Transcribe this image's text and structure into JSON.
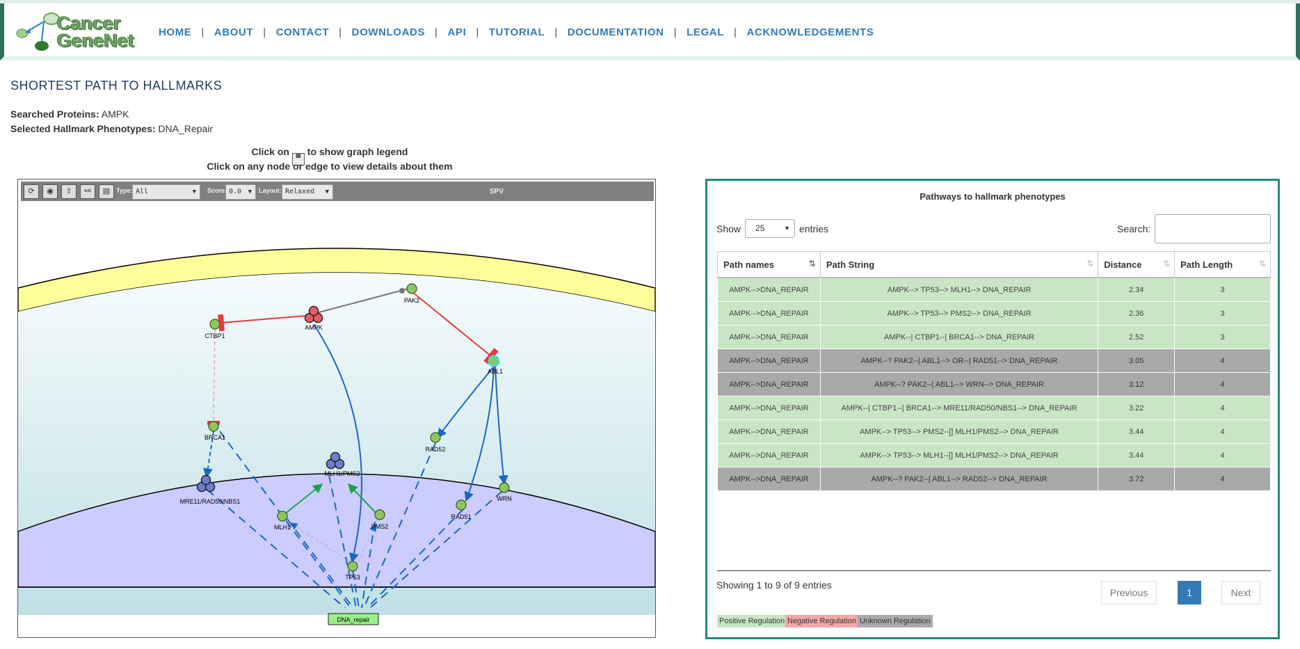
{
  "logo": {
    "line1": "Cancer",
    "line2": "GeneNet"
  },
  "nav": [
    "HOME",
    "ABOUT",
    "CONTACT",
    "DOWNLOADS",
    "API",
    "TUTORIAL",
    "DOCUMENTATION",
    "LEGAL",
    "ACKNOWLEDGEMENTS"
  ],
  "page": {
    "title": "SHORTEST PATH TO HALLMARKS",
    "searched_label": "Searched Proteins:",
    "searched_value": "AMPK",
    "hallmark_label": "Selected Hallmark Phenotypes:",
    "hallmark_value": "DNA_Repair",
    "hint1_pre": "Click on",
    "hint1_post": "to show graph legend",
    "hint2": "Click on any node or edge to view details about them"
  },
  "toolbar": {
    "type_label": "Type:",
    "type_value": "All",
    "score_label": "Score:",
    "score_value": "0.0",
    "layout_label": "Layout:",
    "layout_value": "Relaxed",
    "view_label": "SPV"
  },
  "graph": {
    "nodes": {
      "pak2": "PAK2",
      "ctbp1": "CTBP1",
      "ampk": "AMPK",
      "abl1": "ABL1",
      "rad52": "RAD52",
      "brca1": "BRCA1",
      "mlh1pms2": "MLH1/PMS2",
      "mlh1": "MLH1",
      "pms2": "PMS2",
      "wrn": "WRN",
      "rad51": "RAD51",
      "mre11": "MRE11/RAD50/NBS1",
      "tp53": "TP53",
      "dna_repair": "DNA_repair"
    },
    "colors": {
      "positive_edge": "#1a66c2",
      "negative_edge": "#e83a3a",
      "unknown_edge": "#777777",
      "node_green": "#8fc460",
      "complex_blue": "#6a7fd0",
      "ampk_red": "#e85a66"
    }
  },
  "table": {
    "title": "Pathways to hallmark phenotypes",
    "show_label": "Show",
    "show_value": "25",
    "entries_label": "entries",
    "search_label": "Search:",
    "columns": [
      "Path names",
      "Path String",
      "Distance",
      "Path Length"
    ],
    "rows": [
      {
        "name": "AMPK-->DNA_REPAIR",
        "path": "AMPK--> TP53--> MLH1--> DNA_REPAIR",
        "distance": "2.34",
        "length": "3",
        "type": "pos"
      },
      {
        "name": "AMPK-->DNA_REPAIR",
        "path": "AMPK--> TP53--> PMS2--> DNA_REPAIR",
        "distance": "2.36",
        "length": "3",
        "type": "pos"
      },
      {
        "name": "AMPK-->DNA_REPAIR",
        "path": "AMPK--| CTBP1--| BRCA1--> DNA_REPAIR",
        "distance": "2.52",
        "length": "3",
        "type": "pos"
      },
      {
        "name": "AMPK-->DNA_REPAIR",
        "path": "AMPK--? PAK2--| ABL1--> OR--| RAD51--> DNA_REPAIR",
        "distance": "3.05",
        "length": "4",
        "type": "unk"
      },
      {
        "name": "AMPK-->DNA_REPAIR",
        "path": "AMPK--? PAK2--| ABL1--> WRN--> DNA_REPAIR",
        "distance": "3.12",
        "length": "4",
        "type": "unk"
      },
      {
        "name": "AMPK-->DNA_REPAIR",
        "path": "AMPK--| CTBP1--| BRCA1--> MRE11/RAD50/NBS1--> DNA_REPAIR",
        "distance": "3.22",
        "length": "4",
        "type": "pos"
      },
      {
        "name": "AMPK-->DNA_REPAIR",
        "path": "AMPK--> TP53--> PMS2--[] MLH1/PMS2--> DNA_REPAIR",
        "distance": "3.44",
        "length": "4",
        "type": "pos"
      },
      {
        "name": "AMPK-->DNA_REPAIR",
        "path": "AMPK--> TP53--> MLH1--[] MLH1/PMS2--> DNA_REPAIR",
        "distance": "3.44",
        "length": "4",
        "type": "pos"
      },
      {
        "name": "AMPK-->DNA_REPAIR",
        "path": "AMPK--? PAK2--| ABL1--> RAD52--> DNA_REPAIR",
        "distance": "3.72",
        "length": "4",
        "type": "unk"
      }
    ],
    "info": "Showing 1 to 9 of 9 entries",
    "prev": "Previous",
    "current_page": "1",
    "next": "Next"
  },
  "legend": [
    {
      "label": "Positive Regulation",
      "color": "#c8e6c3"
    },
    {
      "label": "Negative Regulation",
      "color": "#f4a7a7"
    },
    {
      "label": "Unknown Regulation",
      "color": "#a9a9a9"
    }
  ]
}
